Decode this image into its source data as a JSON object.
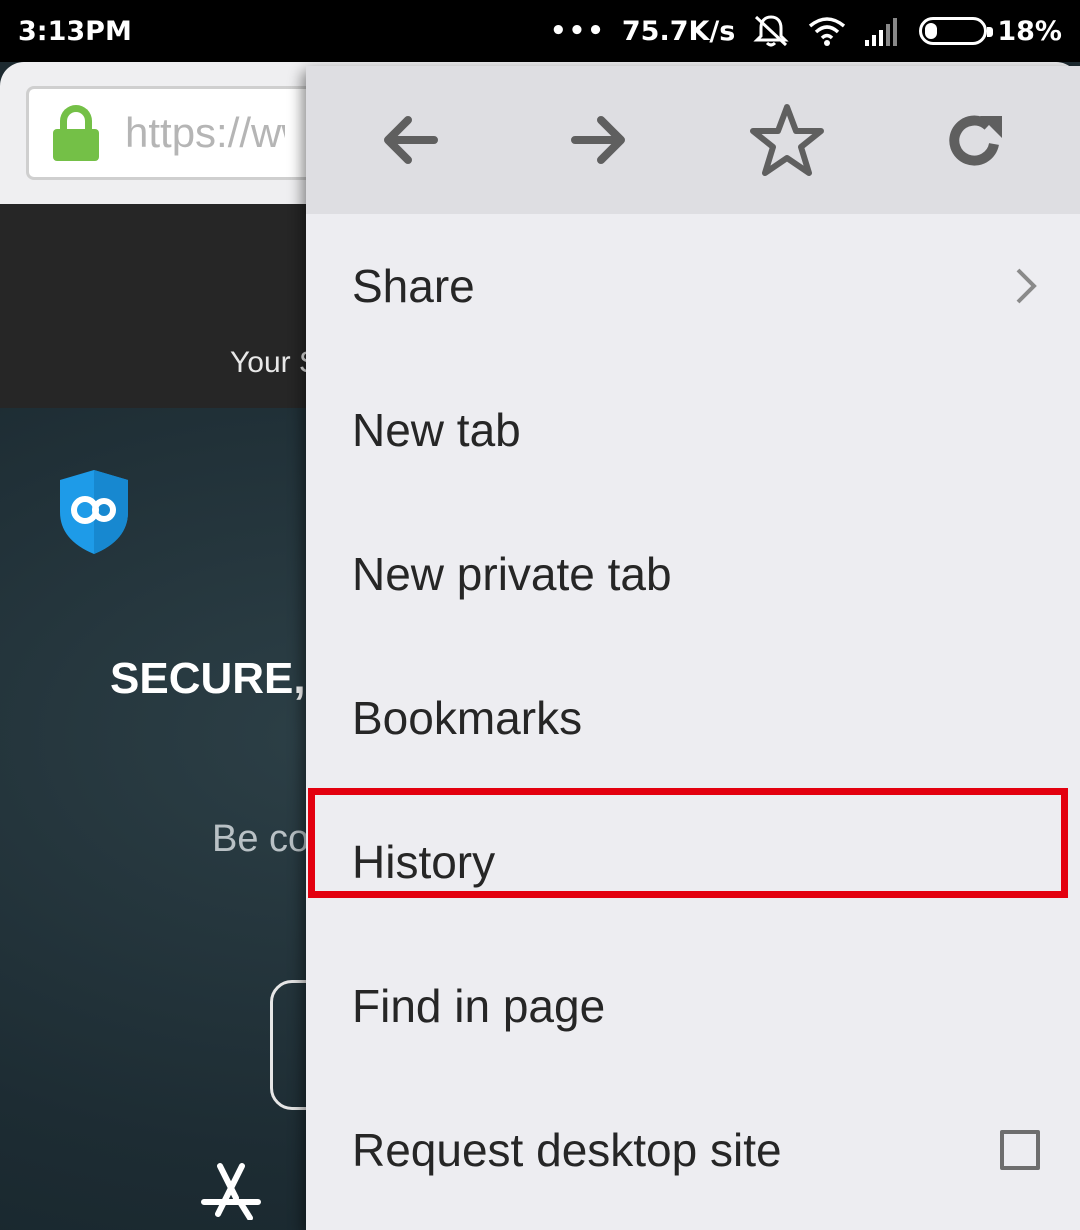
{
  "status_bar": {
    "time": "3:13PM",
    "more": "•••",
    "net_speed": "75.7K/s",
    "battery_pct": "18%",
    "icons": [
      "dnd-icon",
      "wifi-icon",
      "signal-icon",
      "battery-icon"
    ]
  },
  "browser": {
    "url_text": "https://ww"
  },
  "page": {
    "tagline": "Your S",
    "hero_title": "SECURE,",
    "hero_sub": "Be co"
  },
  "menu": {
    "toolbar_icons": [
      "back-arrow-icon",
      "forward-arrow-icon",
      "star-icon",
      "reload-icon"
    ],
    "items": [
      {
        "label": "Share",
        "trailing": "chevron-right-icon"
      },
      {
        "label": "New tab"
      },
      {
        "label": "New private tab"
      },
      {
        "label": "Bookmarks"
      },
      {
        "label": "History",
        "highlighted": true
      },
      {
        "label": "Find in page"
      },
      {
        "label": "Request desktop site",
        "trailing": "checkbox",
        "checked": false
      }
    ],
    "highlight_color": "#e3000f"
  },
  "colors": {
    "lock_green": "#74c047",
    "shield_blue": "#1e9be8"
  }
}
